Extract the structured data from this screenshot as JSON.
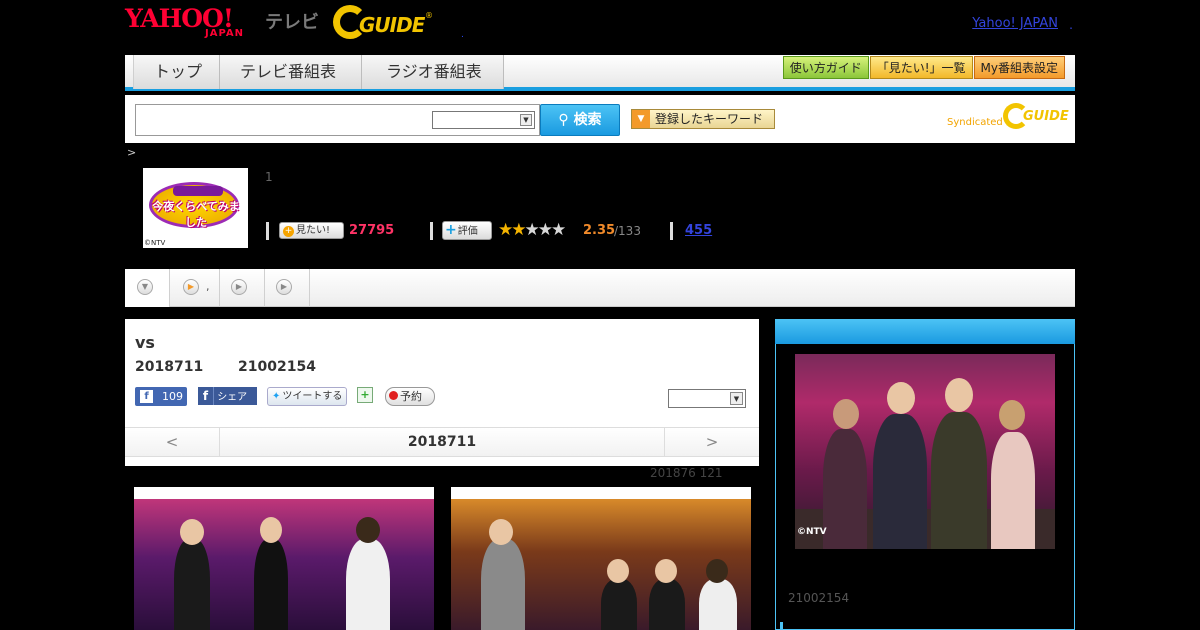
{
  "header": {
    "logo_yahoo": "YAHOO!",
    "logo_japan": "JAPAN",
    "logo_tv": "テレビ",
    "logo_gguide": "GUIDE",
    "logo_reg": "®",
    "yahoo_japan_link": "Yahoo! JAPAN",
    "dot": ".",
    "comma": "."
  },
  "nav": {
    "tabs": [
      {
        "label": "トップ"
      },
      {
        "label": "テレビ番組表"
      },
      {
        "label": "ラジオ番組表"
      }
    ],
    "buttons": [
      {
        "label": "使い方ガイド"
      },
      {
        "label": "「見たい!」一覧"
      },
      {
        "label": "My番組表設定"
      }
    ]
  },
  "search": {
    "button_label": "検索",
    "keyword_button_label": "登録したキーワード",
    "syndicated_label": "Syndicated",
    "syndicated_logo": "GUIDE"
  },
  "breadcrumb": ">",
  "program": {
    "thumb_title": "今夜くらべてみました",
    "thumb_copyright": "©NTV",
    "number": "1",
    "mitai_label": "見たい!",
    "mitai_count": "27795",
    "hyoka_label": "評価",
    "rating": 2.35,
    "rating_value": "2.35",
    "rating_total": "/133",
    "stars_total": 5,
    "link_count": "455"
  },
  "tabstrip": {
    "items": [
      {
        "icon": "▼"
      },
      {
        "icon": "▶",
        "label": ","
      },
      {
        "icon": "▶"
      },
      {
        "icon": "▶"
      }
    ]
  },
  "episode": {
    "title": "vs",
    "date": "2018711",
    "time": "21002154",
    "fb_like_count": "109",
    "fb_share_label": "シェア",
    "tweet_label": "ツイートする",
    "reserve_label": "予約",
    "pager_prev": "<",
    "pager_current": "2018711",
    "pager_next": ">",
    "updated": "201876  121"
  },
  "sidebar": {
    "photo_copyright": "©NTV",
    "date": "21002154"
  }
}
